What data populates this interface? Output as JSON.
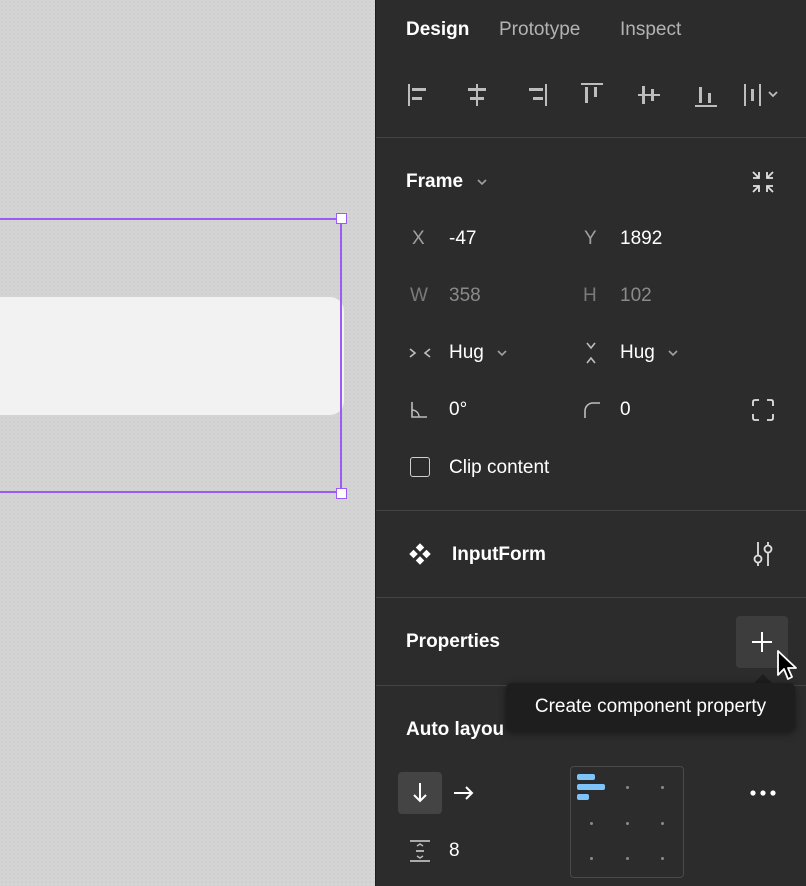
{
  "panel": {
    "tabs": [
      {
        "label": "Design",
        "active": true
      },
      {
        "label": "Prototype",
        "active": false
      },
      {
        "label": "Inspect",
        "active": false
      }
    ],
    "align_tools": [
      "align-left-icon",
      "align-horizontal-center-icon",
      "align-right-icon",
      "align-top-icon",
      "align-vertical-center-icon",
      "align-bottom-icon",
      "distribute-icon"
    ],
    "frame": {
      "title": "Frame",
      "x_label": "X",
      "x_value": "-47",
      "y_label": "Y",
      "y_value": "1892",
      "w_label": "W",
      "w_value": "358",
      "h_label": "H",
      "h_value": "102",
      "horizontal_resizing": "Hug",
      "vertical_resizing": "Hug",
      "rotation": "0°",
      "corner_radius": "0",
      "clip_content_label": "Clip content",
      "clip_content_checked": false
    },
    "component": {
      "name": "InputForm"
    },
    "properties": {
      "title": "Properties",
      "tooltip": "Create component property"
    },
    "auto_layout": {
      "title": "Auto layou",
      "direction": "vertical",
      "spacing": "8"
    }
  },
  "colors": {
    "selection": "#9a5cf5",
    "panel_bg": "#2c2c2c",
    "canvas_bg": "#d4d4d4",
    "accent_blue": "#7cc4fa"
  }
}
